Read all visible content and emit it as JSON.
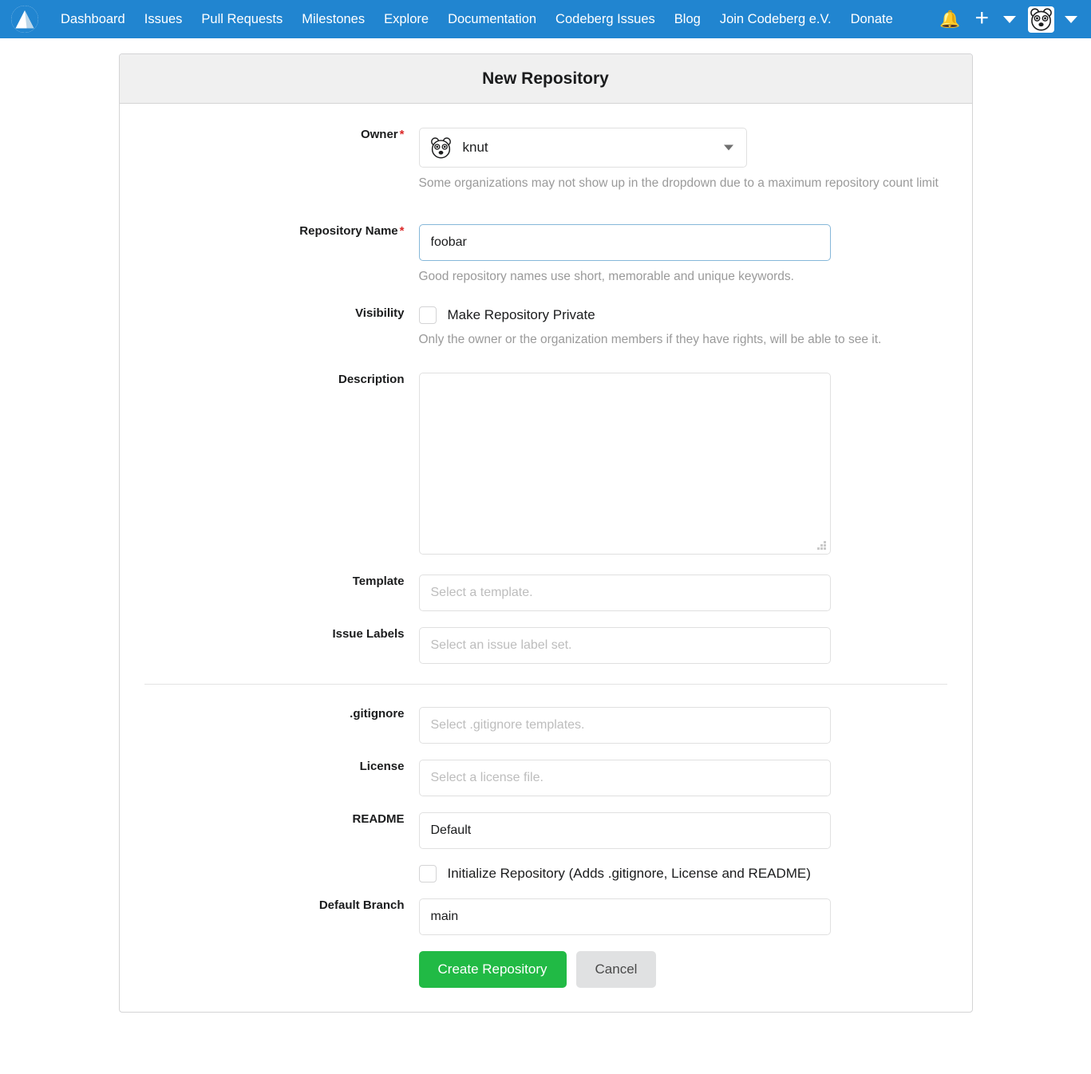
{
  "navbar": {
    "logo_icon": "codeberg-logo-icon",
    "links": [
      {
        "label": "Dashboard"
      },
      {
        "label": "Issues"
      },
      {
        "label": "Pull Requests"
      },
      {
        "label": "Milestones"
      },
      {
        "label": "Explore"
      },
      {
        "label": "Documentation"
      },
      {
        "label": "Codeberg Issues"
      },
      {
        "label": "Blog"
      },
      {
        "label": "Join Codeberg e.V."
      },
      {
        "label": "Donate"
      }
    ],
    "notifications_icon": "bell-icon",
    "create_icon": "plus-icon",
    "create_caret_icon": "chevron-down-icon",
    "avatar_icon": "polar-bear-avatar-icon",
    "user_caret_icon": "chevron-down-icon",
    "brand_color": "#2185d0"
  },
  "card": {
    "title": "New Repository"
  },
  "form": {
    "owner": {
      "label": "Owner",
      "required": true,
      "value": "knut",
      "avatar_icon": "polar-bear-avatar-icon",
      "caret_icon": "chevron-down-icon",
      "helper": "Some organizations may not show up in the dropdown due to a maximum repository count limit"
    },
    "repo_name": {
      "label": "Repository Name",
      "required": true,
      "value": "foobar",
      "helper": "Good repository names use short, memorable and unique keywords.",
      "focused": true
    },
    "visibility": {
      "label": "Visibility",
      "checkbox_label": "Make Repository Private",
      "checked": false,
      "helper": "Only the owner or the organization members if they have rights, will be able to see it."
    },
    "description": {
      "label": "Description",
      "value": "",
      "placeholder": ""
    },
    "template": {
      "label": "Template",
      "value": "",
      "placeholder": "Select a template."
    },
    "issue_labels": {
      "label": "Issue Labels",
      "value": "",
      "placeholder": "Select an issue label set."
    },
    "gitignore": {
      "label": ".gitignore",
      "value": "",
      "placeholder": "Select .gitignore templates."
    },
    "license": {
      "label": "License",
      "value": "",
      "placeholder": "Select a license file."
    },
    "readme": {
      "label": "README",
      "value": "Default",
      "placeholder": ""
    },
    "initialize": {
      "checkbox_label": "Initialize Repository (Adds .gitignore, License and README)",
      "checked": false
    },
    "default_branch": {
      "label": "Default Branch",
      "value": "main",
      "placeholder": ""
    },
    "actions": {
      "submit_label": "Create Repository",
      "cancel_label": "Cancel",
      "submit_color": "#21ba45",
      "cancel_color": "#e0e1e2"
    }
  }
}
